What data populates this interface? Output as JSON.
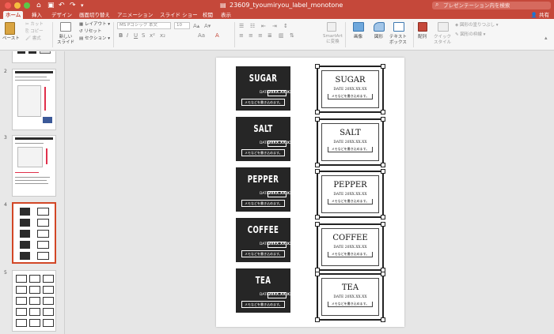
{
  "window": {
    "title": "23609_tyoumiryou_label_monotone",
    "search_placeholder": "プレゼンテーション内を検索",
    "share_label": "共有"
  },
  "tabs": [
    {
      "label": "ホーム",
      "active": true
    },
    {
      "label": "挿入"
    },
    {
      "label": "デザイン"
    },
    {
      "label": "画面切り替え"
    },
    {
      "label": "アニメーション"
    },
    {
      "label": "スライド ショー"
    },
    {
      "label": "校閲"
    },
    {
      "label": "表示"
    }
  ],
  "ribbon": {
    "paste": "ペースト",
    "cut": "カット",
    "copy": "コピー",
    "format": "書式",
    "new_slide": "新しい\nスライド",
    "layout": "レイアウト",
    "reset": "リセット",
    "section": "セクション",
    "font_name": "MS Pゴシック 本文",
    "font_size": "10",
    "smartart": "SmartArt\nに変換",
    "picture": "画像",
    "shapes": "図形",
    "textbox": "テキスト\nボックス",
    "arrange": "配列",
    "quick_styles": "クイック\nスタイル",
    "shape_fill": "図形の塗りつぶし",
    "shape_outline": "図形の枠線"
  },
  "thumbnails": [
    {
      "number": "2"
    },
    {
      "number": "3"
    },
    {
      "number": "4",
      "selected": true
    },
    {
      "number": "5"
    }
  ],
  "slide": {
    "date_label": "DATE",
    "date_value": "20XX.XX.XX",
    "memo_text": "メモなどを書き込めます。",
    "light_date": "DATE 20XX.XX.XX",
    "labels": [
      {
        "name": "SUGAR"
      },
      {
        "name": "SALT"
      },
      {
        "name": "PEPPER"
      },
      {
        "name": "COFFEE"
      },
      {
        "name": "TEA"
      }
    ]
  },
  "colors": {
    "accent": "#c5483a",
    "selection": "#d24726",
    "label_dark": "#262626"
  }
}
